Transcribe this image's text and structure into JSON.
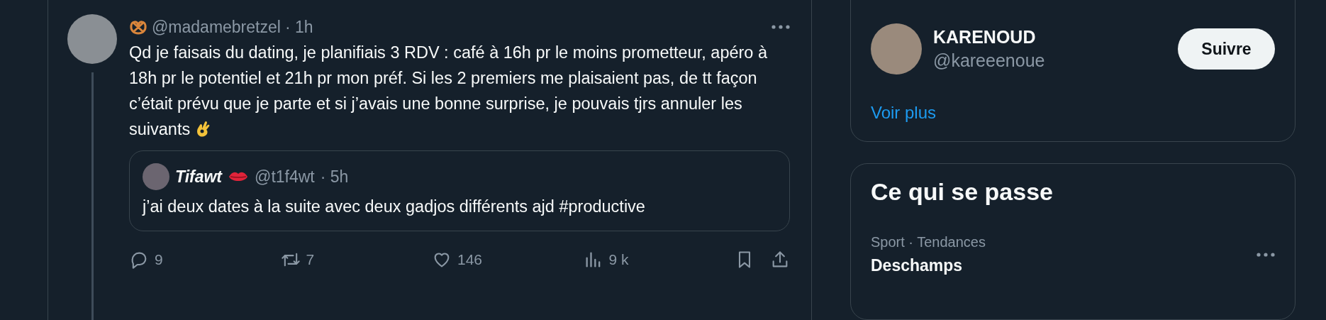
{
  "tweet": {
    "handle": "@madamebretzel",
    "time": "· 1h",
    "text": "Qd je faisais du dating, je planifiais 3 RDV : café à 16h pr le moins prometteur, apéro à 18h pr le potentiel et 21h pr mon préf. Si les 2 premiers me plaisaient pas, de tt façon c’était prévu que je parte et si j’avais une bonne surprise, je pouvais tjrs annuler les suivants",
    "quote": {
      "name": "Tifawt",
      "handle": "@t1f4wt",
      "time": "· 5h",
      "text": "j’ai deux dates à la suite avec deux gadjos différents ajd #productive"
    },
    "actions": [
      {
        "kind": "reply",
        "count": "9"
      },
      {
        "kind": "repost",
        "count": "7"
      },
      {
        "kind": "like",
        "count": "146"
      },
      {
        "kind": "views",
        "count": "9 k"
      },
      {
        "kind": "bookmark"
      },
      {
        "kind": "share"
      }
    ]
  },
  "who_to_follow": {
    "users": [
      {
        "name": "KARENOUD",
        "handle": "@kareeenoue",
        "button": "Suivre"
      }
    ],
    "more_link": "Voir plus"
  },
  "trends": {
    "title": "Ce qui se passe",
    "items": [
      {
        "context": "Sport · Tendances",
        "name": "Deschamps"
      }
    ]
  }
}
